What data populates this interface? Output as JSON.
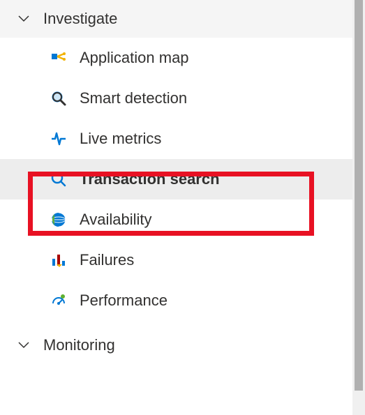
{
  "sections": {
    "investigate": {
      "label": "Investigate",
      "items": [
        {
          "label": "Application map"
        },
        {
          "label": "Smart detection"
        },
        {
          "label": "Live metrics"
        },
        {
          "label": "Transaction search"
        },
        {
          "label": "Availability"
        },
        {
          "label": "Failures"
        },
        {
          "label": "Performance"
        }
      ]
    },
    "monitoring": {
      "label": "Monitoring"
    }
  }
}
